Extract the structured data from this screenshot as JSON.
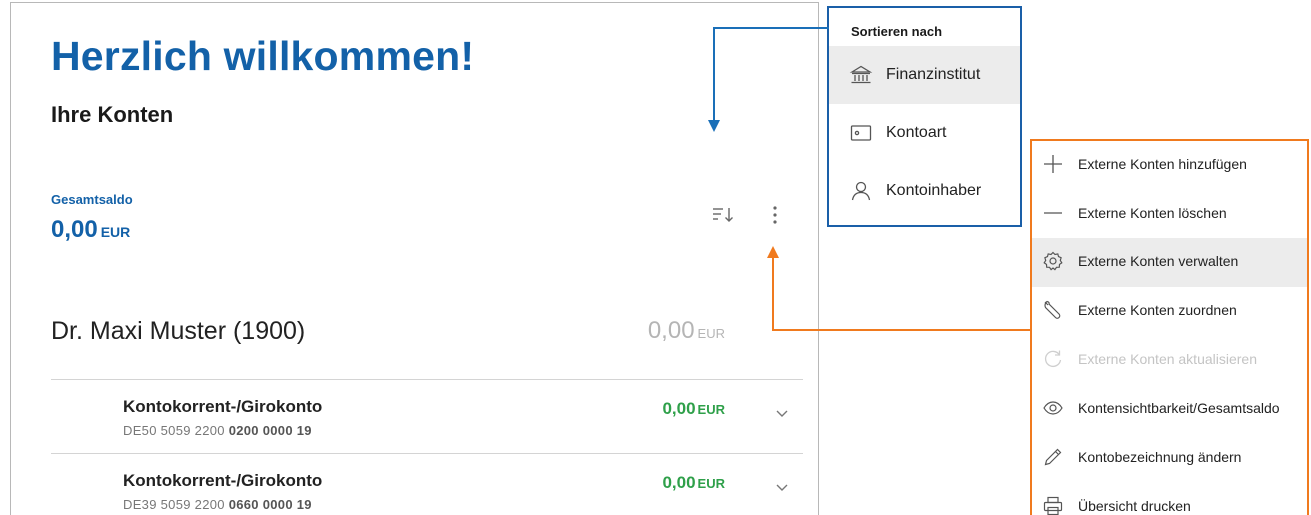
{
  "main": {
    "welcome": "Herzlich willkommen!",
    "accounts_title": "Ihre Konten",
    "total_label": "Gesamtsaldo",
    "total_amount": "0,00",
    "total_currency": "EUR",
    "sort_icon": "sort-icon",
    "more_icon": "more-vertical-icon",
    "owner": {
      "name": "Dr. Maxi Muster (1900)",
      "amount": "0,00",
      "currency": "EUR"
    },
    "accounts": [
      {
        "name": "Kontokorrent-/Girokonto",
        "iban_prefix": "DE50 5059 2200",
        "iban_bold": "0200 0000 19",
        "amount": "0,00",
        "currency": "EUR"
      },
      {
        "name": "Kontokorrent-/Girokonto",
        "iban_prefix": "DE39 5059 2200",
        "iban_bold": "0660 0000 19",
        "amount": "0,00",
        "currency": "EUR"
      }
    ]
  },
  "sort_menu": {
    "heading": "Sortieren nach",
    "items": [
      {
        "label": "Finanzinstitut",
        "icon": "bank-icon",
        "selected": true
      },
      {
        "label": "Kontoart",
        "icon": "card-icon",
        "selected": false
      },
      {
        "label": "Kontoinhaber",
        "icon": "person-icon",
        "selected": false
      }
    ]
  },
  "actions_menu": {
    "items": [
      {
        "label": "Externe Konten hinzufügen",
        "icon": "plus-icon",
        "disabled": false
      },
      {
        "label": "Externe Konten löschen",
        "icon": "minus-icon",
        "disabled": false
      },
      {
        "label": "Externe Konten verwalten",
        "icon": "gear-icon",
        "disabled": false,
        "highlighted": true
      },
      {
        "label": "Externe Konten zuordnen",
        "icon": "wrench-icon",
        "disabled": false
      },
      {
        "label": "Externe Konten aktualisieren",
        "icon": "refresh-icon",
        "disabled": true
      },
      {
        "label": "Kontensichtbarkeit/Gesamtsaldo",
        "icon": "eye-icon",
        "disabled": false
      },
      {
        "label": "Kontobezeichnung ändern",
        "icon": "pencil-icon",
        "disabled": false
      },
      {
        "label": "Übersicht drucken",
        "icon": "printer-icon",
        "disabled": false
      }
    ]
  },
  "colors": {
    "brand_blue": "#1361a8",
    "positive_green": "#2fa04a",
    "sort_callout": "#1a5fa8",
    "actions_callout": "#f07a1e"
  }
}
